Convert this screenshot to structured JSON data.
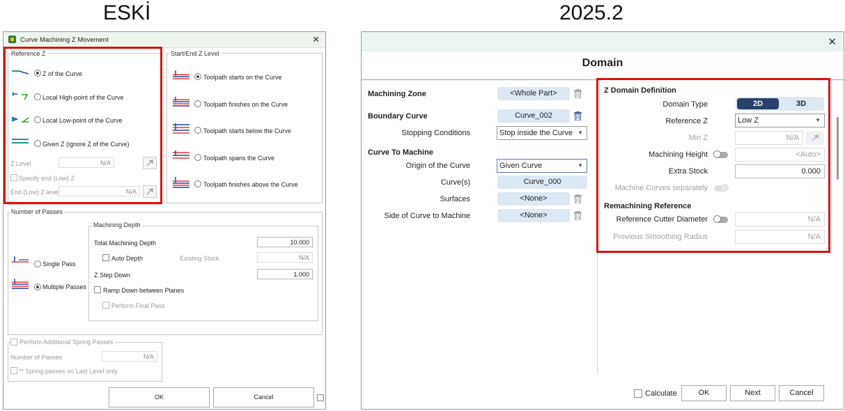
{
  "captions": {
    "old": "ESKİ",
    "new": "2025.2"
  },
  "old_dialog": {
    "title": "Curve Machining Z Movement",
    "reference_z": {
      "group_label": "Reference Z",
      "options": [
        "Z of the Curve",
        "Local High-point of the Curve",
        "Local Low-point of the Curve",
        "Given Z (ignore Z of the Curve)"
      ],
      "selected_index": 0,
      "z_level_label": "Z Level",
      "z_level_value": "N/A",
      "specify_end_label": "Specify end (Low) Z",
      "end_z_label": "End (Low) Z level",
      "end_z_value": "N/A"
    },
    "start_end": {
      "group_label": "Start/End Z Level",
      "options": [
        "Toolpath starts on the Curve",
        "Toolpath finishes on the Curve",
        "Toolpath starts below the Curve",
        "Toolpath spans the Curve",
        "Toolpath finishes above the Curve"
      ],
      "selected_index": 0
    },
    "passes": {
      "group_label": "Number of Passes",
      "single_label": "Single Pass",
      "multiple_label": "Multiple Passes",
      "selected": "multiple",
      "depth_group_label": "Machining Depth",
      "total_depth_label": "Total Machining Depth",
      "total_depth_value": "10.000",
      "auto_depth_label": "Auto Depth",
      "existing_stock_label": "Existing Stock",
      "existing_stock_value": "N/A",
      "z_step_label": "Z Step Down",
      "z_step_value": "1.000",
      "ramp_label": "Ramp Down between Planes",
      "final_pass_label": "Perform Final Pass"
    },
    "spring": {
      "group_label": "Perform Additional Spring Passes",
      "num_passes_label": "Number of Passes",
      "num_passes_value": "N/A",
      "last_level_label": "** Spring passes on Last Level only"
    },
    "ok_label": "OK",
    "cancel_label": "Cancel"
  },
  "new_dialog": {
    "header_title": "Domain",
    "machining_zone_label": "Machining Zone",
    "machining_zone_value": "<Whole Part>",
    "boundary_curve_label": "Boundary Curve",
    "boundary_curve_value": "Curve_002",
    "stopping_conditions_label": "Stopping Conditions",
    "stopping_conditions_value": "Stop inside the Curve",
    "curve_to_machine_label": "Curve To Machine",
    "origin_label": "Origin of the Curve",
    "origin_value": "Given Curve",
    "curves_label": "Curve(s)",
    "curves_value": "Curve_000",
    "surfaces_label": "Surfaces",
    "surfaces_value": "<None>",
    "side_label": "Side of Curve to Machine",
    "side_value": "<None>",
    "z_domain": {
      "section_label": "Z Domain Definition",
      "domain_type_label": "Domain Type",
      "domain_type_options": [
        "2D",
        "3D"
      ],
      "domain_type_selected": "2D",
      "reference_z_label": "Reference Z",
      "reference_z_value": "Low Z",
      "min_z_label": "Min Z",
      "min_z_value": "N/A",
      "machining_height_label": "Machining Height",
      "machining_height_value": "<Auto>",
      "extra_stock_label": "Extra Stock",
      "extra_stock_value": "0.000",
      "separately_label": "Machine Curves separately"
    },
    "remachining": {
      "section_label": "Remachining Reference",
      "ref_cutter_label": "Reference Cutter Diameter",
      "ref_cutter_value": "N/A",
      "prev_radius_label": "Previous Smoothing Radius",
      "prev_radius_value": "N/A"
    },
    "calculate_label": "Calculate",
    "ok_label": "OK",
    "next_label": "Next",
    "cancel_label": "Cancel"
  },
  "colors": {
    "highlight": "#e01010",
    "accent_dark": "#2b3f6b",
    "pill_bg": "#dce8f3",
    "title_band": "#e9f4f3"
  }
}
